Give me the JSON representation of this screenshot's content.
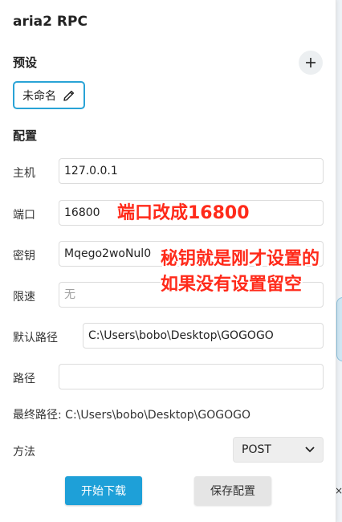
{
  "title": "aria2 RPC",
  "presets": {
    "heading": "预设",
    "add_icon": "plus-icon",
    "current": "未命名",
    "edit_icon": "pencil-icon"
  },
  "config": {
    "heading": "配置",
    "host": {
      "label": "主机",
      "value": "127.0.0.1"
    },
    "port": {
      "label": "端口",
      "value": "16800"
    },
    "secret": {
      "label": "密钥",
      "value": "Mqego2woNul0"
    },
    "speed_limit": {
      "label": "限速",
      "placeholder": "无"
    },
    "default_path": {
      "label": "默认路径",
      "value": "C:\\Users\\bobo\\Desktop\\GOGOGO"
    },
    "path": {
      "label": "路径",
      "value": ""
    },
    "final_path": "最终路径: C:\\Users\\bobo\\Desktop\\GOGOGO",
    "method": {
      "label": "方法",
      "selected": "POST",
      "icon": "chevron-down-icon"
    }
  },
  "buttons": {
    "start_download": "开始下载",
    "save_config": "保存配置"
  },
  "annotations": {
    "port_note": "端口改成16800",
    "secret_note_line1": "秘钥就是刚才设置的",
    "secret_note_line2": "如果没有设置留空"
  },
  "colors": {
    "accent": "#1ea0d8",
    "chip_border": "#29a3d6",
    "annotation": "#ff2a1a"
  }
}
